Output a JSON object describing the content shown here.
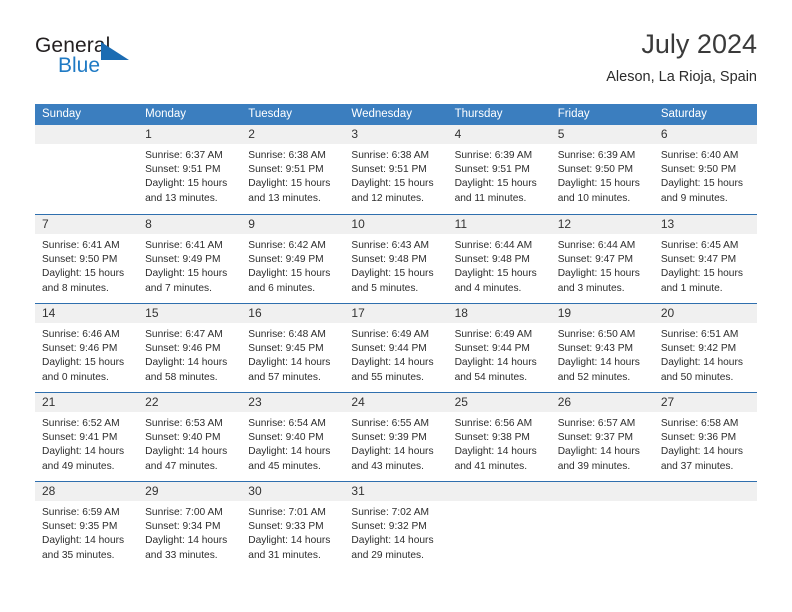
{
  "brand": {
    "name_top": "General",
    "name_bottom": "Blue",
    "accent_color": "#1f7ac4",
    "triangle_color": "#1c6cb2"
  },
  "header": {
    "title": "July 2024",
    "subtitle": "Aleson, La Rioja, Spain"
  },
  "calendar": {
    "header_bg": "#3b7ebf",
    "header_text_color": "#ffffff",
    "row_divider_color": "#2f6fae",
    "day_number_bg": "#f0f0f0",
    "weekdays": [
      "Sunday",
      "Monday",
      "Tuesday",
      "Wednesday",
      "Thursday",
      "Friday",
      "Saturday"
    ],
    "weeks": [
      [
        {
          "day": "",
          "sunrise": "",
          "sunset": "",
          "daylight_line1": "",
          "daylight_line2": ""
        },
        {
          "day": "1",
          "sunrise": "Sunrise: 6:37 AM",
          "sunset": "Sunset: 9:51 PM",
          "daylight_line1": "Daylight: 15 hours",
          "daylight_line2": "and 13 minutes."
        },
        {
          "day": "2",
          "sunrise": "Sunrise: 6:38 AM",
          "sunset": "Sunset: 9:51 PM",
          "daylight_line1": "Daylight: 15 hours",
          "daylight_line2": "and 13 minutes."
        },
        {
          "day": "3",
          "sunrise": "Sunrise: 6:38 AM",
          "sunset": "Sunset: 9:51 PM",
          "daylight_line1": "Daylight: 15 hours",
          "daylight_line2": "and 12 minutes."
        },
        {
          "day": "4",
          "sunrise": "Sunrise: 6:39 AM",
          "sunset": "Sunset: 9:51 PM",
          "daylight_line1": "Daylight: 15 hours",
          "daylight_line2": "and 11 minutes."
        },
        {
          "day": "5",
          "sunrise": "Sunrise: 6:39 AM",
          "sunset": "Sunset: 9:50 PM",
          "daylight_line1": "Daylight: 15 hours",
          "daylight_line2": "and 10 minutes."
        },
        {
          "day": "6",
          "sunrise": "Sunrise: 6:40 AM",
          "sunset": "Sunset: 9:50 PM",
          "daylight_line1": "Daylight: 15 hours",
          "daylight_line2": "and 9 minutes."
        }
      ],
      [
        {
          "day": "7",
          "sunrise": "Sunrise: 6:41 AM",
          "sunset": "Sunset: 9:50 PM",
          "daylight_line1": "Daylight: 15 hours",
          "daylight_line2": "and 8 minutes."
        },
        {
          "day": "8",
          "sunrise": "Sunrise: 6:41 AM",
          "sunset": "Sunset: 9:49 PM",
          "daylight_line1": "Daylight: 15 hours",
          "daylight_line2": "and 7 minutes."
        },
        {
          "day": "9",
          "sunrise": "Sunrise: 6:42 AM",
          "sunset": "Sunset: 9:49 PM",
          "daylight_line1": "Daylight: 15 hours",
          "daylight_line2": "and 6 minutes."
        },
        {
          "day": "10",
          "sunrise": "Sunrise: 6:43 AM",
          "sunset": "Sunset: 9:48 PM",
          "daylight_line1": "Daylight: 15 hours",
          "daylight_line2": "and 5 minutes."
        },
        {
          "day": "11",
          "sunrise": "Sunrise: 6:44 AM",
          "sunset": "Sunset: 9:48 PM",
          "daylight_line1": "Daylight: 15 hours",
          "daylight_line2": "and 4 minutes."
        },
        {
          "day": "12",
          "sunrise": "Sunrise: 6:44 AM",
          "sunset": "Sunset: 9:47 PM",
          "daylight_line1": "Daylight: 15 hours",
          "daylight_line2": "and 3 minutes."
        },
        {
          "day": "13",
          "sunrise": "Sunrise: 6:45 AM",
          "sunset": "Sunset: 9:47 PM",
          "daylight_line1": "Daylight: 15 hours",
          "daylight_line2": "and 1 minute."
        }
      ],
      [
        {
          "day": "14",
          "sunrise": "Sunrise: 6:46 AM",
          "sunset": "Sunset: 9:46 PM",
          "daylight_line1": "Daylight: 15 hours",
          "daylight_line2": "and 0 minutes."
        },
        {
          "day": "15",
          "sunrise": "Sunrise: 6:47 AM",
          "sunset": "Sunset: 9:46 PM",
          "daylight_line1": "Daylight: 14 hours",
          "daylight_line2": "and 58 minutes."
        },
        {
          "day": "16",
          "sunrise": "Sunrise: 6:48 AM",
          "sunset": "Sunset: 9:45 PM",
          "daylight_line1": "Daylight: 14 hours",
          "daylight_line2": "and 57 minutes."
        },
        {
          "day": "17",
          "sunrise": "Sunrise: 6:49 AM",
          "sunset": "Sunset: 9:44 PM",
          "daylight_line1": "Daylight: 14 hours",
          "daylight_line2": "and 55 minutes."
        },
        {
          "day": "18",
          "sunrise": "Sunrise: 6:49 AM",
          "sunset": "Sunset: 9:44 PM",
          "daylight_line1": "Daylight: 14 hours",
          "daylight_line2": "and 54 minutes."
        },
        {
          "day": "19",
          "sunrise": "Sunrise: 6:50 AM",
          "sunset": "Sunset: 9:43 PM",
          "daylight_line1": "Daylight: 14 hours",
          "daylight_line2": "and 52 minutes."
        },
        {
          "day": "20",
          "sunrise": "Sunrise: 6:51 AM",
          "sunset": "Sunset: 9:42 PM",
          "daylight_line1": "Daylight: 14 hours",
          "daylight_line2": "and 50 minutes."
        }
      ],
      [
        {
          "day": "21",
          "sunrise": "Sunrise: 6:52 AM",
          "sunset": "Sunset: 9:41 PM",
          "daylight_line1": "Daylight: 14 hours",
          "daylight_line2": "and 49 minutes."
        },
        {
          "day": "22",
          "sunrise": "Sunrise: 6:53 AM",
          "sunset": "Sunset: 9:40 PM",
          "daylight_line1": "Daylight: 14 hours",
          "daylight_line2": "and 47 minutes."
        },
        {
          "day": "23",
          "sunrise": "Sunrise: 6:54 AM",
          "sunset": "Sunset: 9:40 PM",
          "daylight_line1": "Daylight: 14 hours",
          "daylight_line2": "and 45 minutes."
        },
        {
          "day": "24",
          "sunrise": "Sunrise: 6:55 AM",
          "sunset": "Sunset: 9:39 PM",
          "daylight_line1": "Daylight: 14 hours",
          "daylight_line2": "and 43 minutes."
        },
        {
          "day": "25",
          "sunrise": "Sunrise: 6:56 AM",
          "sunset": "Sunset: 9:38 PM",
          "daylight_line1": "Daylight: 14 hours",
          "daylight_line2": "and 41 minutes."
        },
        {
          "day": "26",
          "sunrise": "Sunrise: 6:57 AM",
          "sunset": "Sunset: 9:37 PM",
          "daylight_line1": "Daylight: 14 hours",
          "daylight_line2": "and 39 minutes."
        },
        {
          "day": "27",
          "sunrise": "Sunrise: 6:58 AM",
          "sunset": "Sunset: 9:36 PM",
          "daylight_line1": "Daylight: 14 hours",
          "daylight_line2": "and 37 minutes."
        }
      ],
      [
        {
          "day": "28",
          "sunrise": "Sunrise: 6:59 AM",
          "sunset": "Sunset: 9:35 PM",
          "daylight_line1": "Daylight: 14 hours",
          "daylight_line2": "and 35 minutes."
        },
        {
          "day": "29",
          "sunrise": "Sunrise: 7:00 AM",
          "sunset": "Sunset: 9:34 PM",
          "daylight_line1": "Daylight: 14 hours",
          "daylight_line2": "and 33 minutes."
        },
        {
          "day": "30",
          "sunrise": "Sunrise: 7:01 AM",
          "sunset": "Sunset: 9:33 PM",
          "daylight_line1": "Daylight: 14 hours",
          "daylight_line2": "and 31 minutes."
        },
        {
          "day": "31",
          "sunrise": "Sunrise: 7:02 AM",
          "sunset": "Sunset: 9:32 PM",
          "daylight_line1": "Daylight: 14 hours",
          "daylight_line2": "and 29 minutes."
        },
        {
          "day": "",
          "sunrise": "",
          "sunset": "",
          "daylight_line1": "",
          "daylight_line2": ""
        },
        {
          "day": "",
          "sunrise": "",
          "sunset": "",
          "daylight_line1": "",
          "daylight_line2": ""
        },
        {
          "day": "",
          "sunrise": "",
          "sunset": "",
          "daylight_line1": "",
          "daylight_line2": ""
        }
      ]
    ]
  }
}
